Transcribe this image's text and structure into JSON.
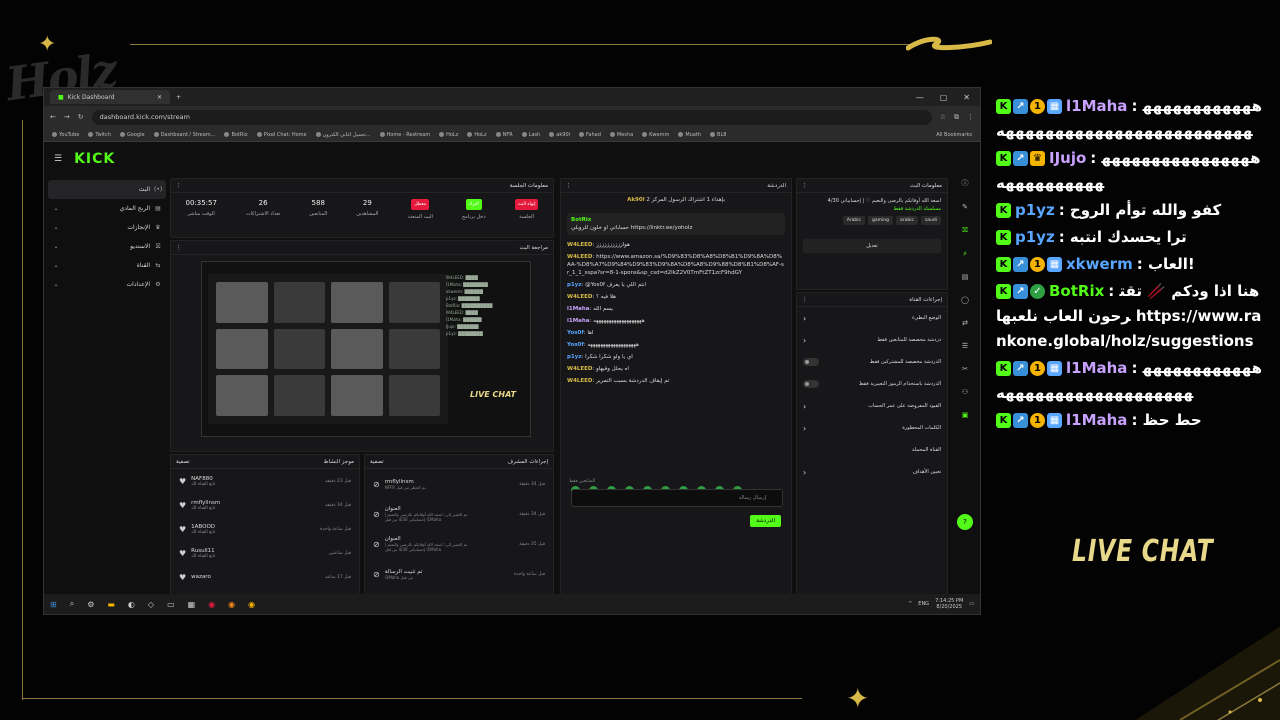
{
  "browser": {
    "tab_title": "Kick Dashboard",
    "url": "dashboard.kick.com/stream",
    "bookmarks": [
      "YouTube",
      "Twitch",
      "Google",
      "Dashboard / Stream...",
      "BotRix",
      "Pixel Chat: Home",
      "تحميل اغاني الكترون...",
      "Home - Restream",
      "HoLz",
      "HoLz",
      "NFR",
      "Lash",
      "ak90l",
      "Fahad",
      "Mesha",
      "Kwemm",
      "Muath",
      "BL8"
    ],
    "all_bookmarks": "All Bookmarks"
  },
  "kick": {
    "logo": "KICK",
    "sidebar": [
      {
        "label": "البث",
        "icon": "(•)"
      },
      {
        "label": "الربح المادي",
        "icon": "▤"
      },
      {
        "label": "الإنجازات",
        "icon": "♛"
      },
      {
        "label": "الاستديو",
        "icon": "⛝"
      },
      {
        "label": "القناة",
        "icon": "⇆"
      },
      {
        "label": "الإعدادات",
        "icon": "⚙"
      }
    ],
    "session": {
      "title": "معلومات الجلسة",
      "stats": [
        {
          "value": "00:35:57",
          "label": "الوقت مباشر"
        },
        {
          "value": "26",
          "label": "تعداد الاشتراكات"
        },
        {
          "value": "588",
          "label": "المتابعين"
        },
        {
          "value": "29",
          "label": "المشاهدين"
        }
      ],
      "pills": [
        {
          "text": "معطل",
          "label": "البث المتعدد",
          "color": "#e5193b"
        },
        {
          "text": "الترك",
          "label": "دخل برنامج",
          "color": "#53fc18"
        },
        {
          "text": "إنهاء البث",
          "label": "الجلسة",
          "color": "#e5193b"
        }
      ]
    },
    "preview": {
      "title": "مراجعة البث",
      "live_chat": "LIVE CHAT"
    },
    "activity": {
      "title": "موجز النشاط",
      "filter": "تصفية",
      "rows": [
        {
          "name": "NAF880",
          "sub": "تابع القناة لك",
          "time": "قبل 23 دقيقة"
        },
        {
          "name": "rmflyllnsm",
          "sub": "تابع القناة لك",
          "time": "قبل 34 دقيقة"
        },
        {
          "name": "1ABOOD",
          "sub": "تابع القناة لك",
          "time": "قبل ساعة واحدة"
        },
        {
          "name": "Rusull11",
          "sub": "تابع القناة لك",
          "time": "قبل ساعتين"
        },
        {
          "name": "wazaro",
          "sub": "",
          "time": "قبل 17 ساعة"
        }
      ]
    },
    "modactions": {
      "title": "إجراءات المشرف",
      "filter": "تصفية",
      "rows": [
        {
          "name": "rmflyllnsm",
          "sub": "NFFR تم الحظر من قبل",
          "time": "قبل 34 دقيقة"
        },
        {
          "name": "العنوان",
          "sub": "تم التغيير إلى: اسعد الله أوقاتكم بالرضى والنعيم | إحسابياتي 4/30 من قبل l1Maha",
          "time": "قبل 34 دقيقة"
        },
        {
          "name": "العنوان",
          "sub": "تم التغيير إلى: اسعد الله أوقاتكم بالرضى والنعيم | إحسابياتي 4/30 من قبل l1Maha",
          "time": "قبل 35 دقيقة"
        },
        {
          "name": "تم تثبيت الرسالة",
          "sub": "l1Maha من قبل",
          "time": "قبل ساعة واحدة"
        }
      ]
    },
    "chat": {
      "title": "الدردشة",
      "top_user": "Ak90l",
      "top_text": "بإهداء 1 اشتراك الرسول المركز 2",
      "pinned_user": "BotRix",
      "pinned_text": "حساباتي او خلون للروبلي https://linktr.ee/yoholz",
      "messages": [
        {
          "user": "W4LEED",
          "text": "هوازززززززززز",
          "color": "#d8b947"
        },
        {
          "user": "W4LEED",
          "text": "https://www.amazon.sa/%D9%83%D8%A8%D8%B1%D9%8A%D8%AA-%D8%A7%D9%84%D9%83%D9%8A%D8%A8%D9%88%D8%B1%D8%AF-sr_1_1_sspa?sr=8-1-spons&sp_csd=d2lkZ2V0TmFtZT1zcF9hdGY",
          "color": "#d8b947"
        },
        {
          "user": "p1yz",
          "text": "@Yos0f انتم اللي يا يعرف",
          "color": "#58a6ff"
        },
        {
          "user": "W4LEED",
          "text": "هلا فيه ؟",
          "color": "#d8b947"
        },
        {
          "user": "l1Maha",
          "text": "يسم الله",
          "color": "#c8a2ff"
        },
        {
          "user": "l1Maha",
          "text": "هههههههههههههههههههه",
          "color": "#c8a2ff"
        },
        {
          "user": "Yos0f",
          "text": "اها",
          "color": "#58a6ff"
        },
        {
          "user": "Yos0f",
          "text": "هههههههههههههههههههه",
          "color": "#58a6ff"
        },
        {
          "user": "p1yz",
          "text": "اي يا ولو شكرا شكرا",
          "color": "#58a6ff"
        },
        {
          "user": "W4LEED",
          "text": "اه يحلل وقيهاو",
          "color": "#d8b947"
        },
        {
          "user": "W4LEED",
          "text": "تم إيقاف الدردشة بسبب التمرير",
          "color": "#d8b947"
        }
      ],
      "followers_only": "المتابعين فقط",
      "placeholder": "إرسال رسالة",
      "send": "الدردشة"
    },
    "stream_info": {
      "title": "معلومات البث",
      "stream_title": "اسعد الله أوقاتكم بالرضى والنعيم ♡ | إحسابياتي 4/30",
      "category": "مسلسلة الدردشة فقط",
      "tags": [
        "Arabic",
        "gaming",
        "arabic",
        "saudi"
      ],
      "edit": "تعديل"
    },
    "channel_actions": {
      "title": "إجراءات القناة",
      "rows": [
        {
          "label": "الوضع البطيء",
          "control": "chevron"
        },
        {
          "label": "دردشة مخصصة للمتابعين فقط",
          "control": "chevron"
        },
        {
          "label": "الدردشة مخصصة للمشتركين فقط",
          "control": "toggle"
        },
        {
          "label": "الدردشة باستخدام الرموز التعبيرية فقط",
          "control": "toggle"
        },
        {
          "label": "القيود المفروضة على عمر الحساب",
          "control": "chevron"
        },
        {
          "label": "الكلمات المحظورة",
          "control": "chevron"
        },
        {
          "label": "القناة المحملة",
          "control": "none"
        },
        {
          "label": "تعيين الأهداف",
          "control": "chevron"
        }
      ]
    }
  },
  "taskbar": {
    "lang": "ENG",
    "time": "7:14:25 PM",
    "date": "8/20/2025"
  },
  "overlay": {
    "live_chat": "LIVE CHAT",
    "logo": "Holz",
    "messages": [
      {
        "user": "l1Maha",
        "color": "#c8a2ff",
        "badges": [
          "k",
          "up",
          "1",
          "bars"
        ],
        "text": "هههههههههههههههههههههههههههههههههههههه"
      },
      {
        "user": "IJujo",
        "color": "#c8a2ff",
        "badges": [
          "k",
          "up",
          "crown"
        ],
        "text": "ههههههههههههههههههههههههههه"
      },
      {
        "user": "p1yz",
        "color": "#58a6ff",
        "badges": [
          "k"
        ],
        "text": "كفو والله توأم الروح"
      },
      {
        "user": "p1yz",
        "color": "#58a6ff",
        "badges": [
          "k"
        ],
        "text": "ترا يحسدك انتبه"
      },
      {
        "user": "xkwerm",
        "color": "#58a6ff",
        "badges": [
          "k",
          "up",
          "1",
          "bars"
        ],
        "text": "العاب!"
      },
      {
        "user": "BotRix",
        "color": "#53fc18",
        "badges": [
          "k",
          "up",
          "check"
        ],
        "text": "هنا اذا ودكم 🥢 تقترحون العاب نلعبها https://www.rankone.global/holz/suggestions"
      },
      {
        "user": "l1Maha",
        "color": "#c8a2ff",
        "badges": [
          "k",
          "up",
          "1",
          "bars"
        ],
        "text": "هههههههههههههههههههههههههههههههه"
      },
      {
        "user": "l1Maha",
        "color": "#c8a2ff",
        "badges": [
          "k",
          "up",
          "1",
          "bars"
        ],
        "text": "حط حظ"
      }
    ]
  }
}
